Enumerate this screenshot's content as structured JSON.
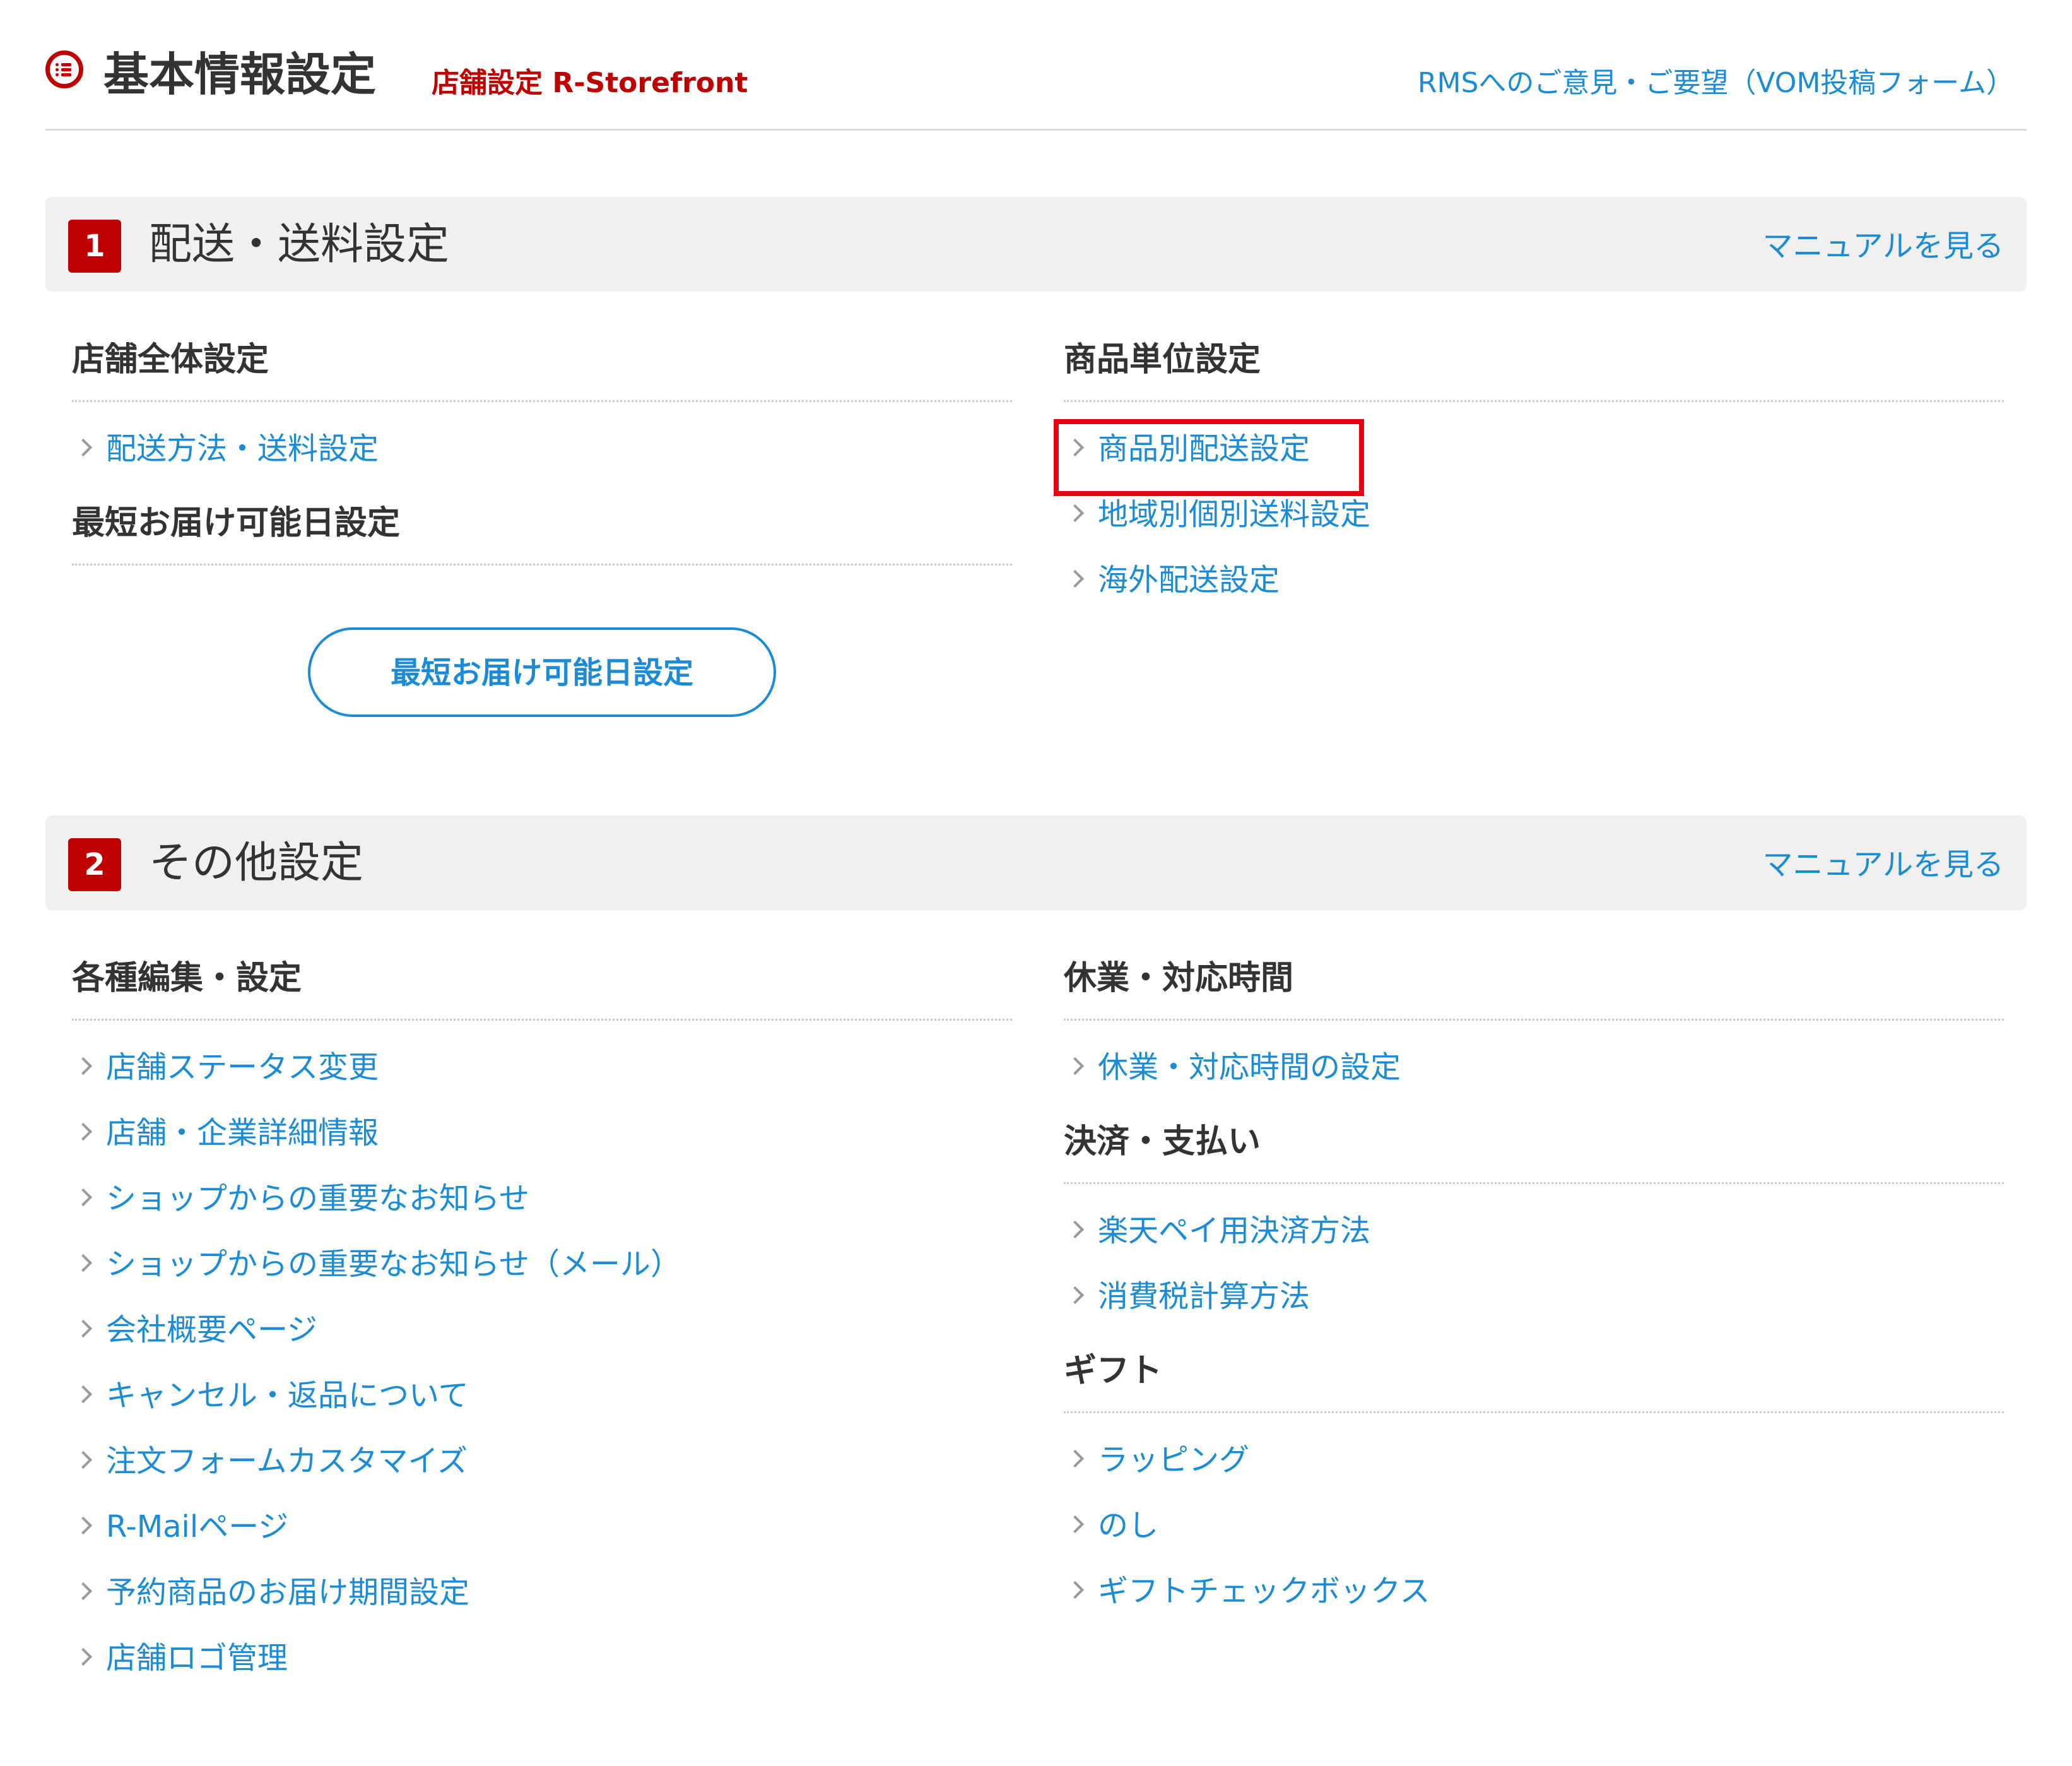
{
  "header": {
    "title": "基本情報設定",
    "subtitle": "店舗設定 R-Storefront",
    "feedback_link": "RMSへのご意見・ご要望（VOM投稿フォーム）",
    "icon": "list-circle-icon"
  },
  "colors": {
    "brand_red": "#bf0000",
    "link_blue": "#1c8bd6",
    "highlight_red": "#e60012",
    "section_bg": "#f0f0f0"
  },
  "sections": [
    {
      "number": "1",
      "title": "配送・送料設定",
      "manual_link": "マニュアルを見る",
      "left_groups": [
        {
          "heading": "店舗全体設定",
          "links": [
            "配送方法・送料設定"
          ]
        },
        {
          "heading": "最短お届け可能日設定",
          "button_label": "最短お届け可能日設定"
        }
      ],
      "right_groups": [
        {
          "heading": "商品単位設定",
          "links": [
            "商品別配送設定",
            "地域別個別送料設定",
            "海外配送設定"
          ]
        }
      ]
    },
    {
      "number": "2",
      "title": "その他設定",
      "manual_link": "マニュアルを見る",
      "left_groups": [
        {
          "heading": "各種編集・設定",
          "links": [
            "店舗ステータス変更",
            "店舗・企業詳細情報",
            "ショップからの重要なお知らせ",
            "ショップからの重要なお知らせ（メール）",
            "会社概要ページ",
            "キャンセル・返品について",
            "注文フォームカスタマイズ",
            "R-Mailページ",
            "予約商品のお届け期間設定",
            "店舗ロゴ管理"
          ]
        }
      ],
      "right_groups": [
        {
          "heading": "休業・対応時間",
          "links": [
            "休業・対応時間の設定"
          ]
        },
        {
          "heading": "決済・支払い",
          "links": [
            "楽天ペイ用決済方法",
            "消費税計算方法"
          ]
        },
        {
          "heading": "ギフト",
          "links": [
            "ラッピング",
            "のし",
            "ギフトチェックボックス"
          ]
        }
      ]
    }
  ],
  "highlighted_link": "商品別配送設定"
}
